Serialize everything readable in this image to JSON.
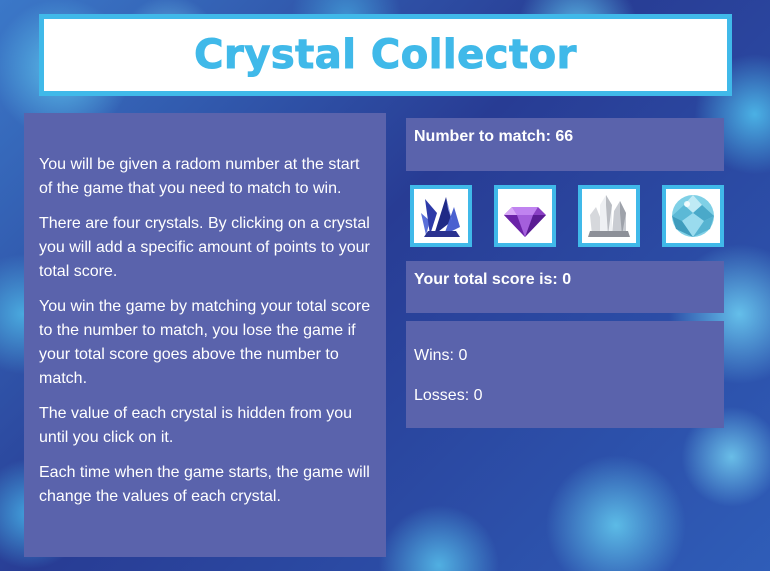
{
  "title": "Crystal Collector",
  "instructions": [
    "You will be given a radom number at the start of the game that you need to match to win.",
    "There are four crystals. By clicking on a crystal you will add a specific amount of points to your total score.",
    "You win the game by matching your total score to the number to match, you lose the game if your total score goes above the number to match.",
    "The value of each crystal is hidden from you until you click on it.",
    "Each time when the game starts, the game will change the values of each crystal."
  ],
  "target": {
    "label": "Number to match: ",
    "value": "66"
  },
  "crystals": [
    {
      "name": "blue-crystal-cluster-icon"
    },
    {
      "name": "purple-gem-icon"
    },
    {
      "name": "clear-quartz-icon"
    },
    {
      "name": "aqua-crystal-ball-icon"
    }
  ],
  "score": {
    "label": "Your total score is: ",
    "value": "0"
  },
  "stats": {
    "wins_label": "Wins: ",
    "wins": "0",
    "losses_label": "Losses: ",
    "losses": "0"
  },
  "colors": {
    "accent": "#40b9e9",
    "panel": "#5a63ac",
    "text": "#ffffff"
  }
}
